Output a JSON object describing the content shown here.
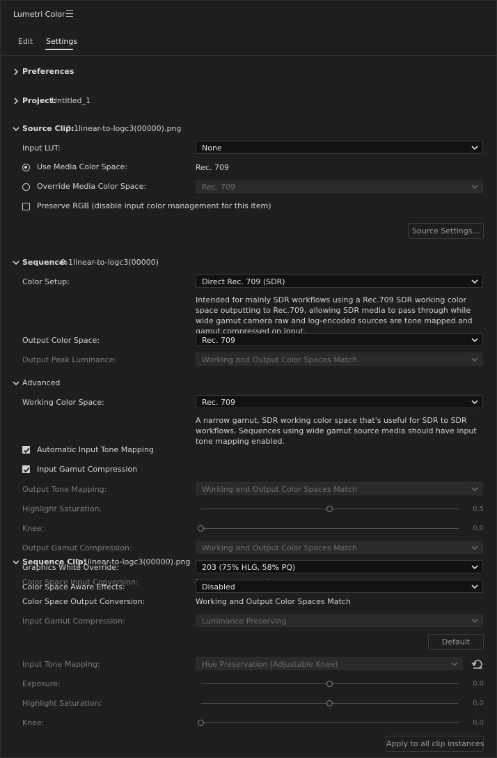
{
  "header": {
    "title": "Lumetri Color"
  },
  "tabs": [
    {
      "label": "Edit"
    },
    {
      "label": "Settings"
    }
  ],
  "sections": {
    "preferences": {
      "label": "Preferences"
    },
    "project": {
      "label": "Project:",
      "value": "Untitled_1"
    },
    "source_clip": {
      "label": "Source Clip:",
      "value": "0-1linear-to-logc3(00000).png",
      "input_lut_label": "Input LUT:",
      "input_lut_value": "None",
      "use_media_label": "Use Media Color Space:",
      "use_media_value": "Rec. 709",
      "override_label": "Override Media Color Space:",
      "override_value": "Rec. 709",
      "preserve_rgb_label": "Preserve RGB (disable input color management for this item)",
      "source_settings_button": "Source Settings..."
    },
    "sequence": {
      "label": "Sequence:",
      "value": "0-1linear-to-logc3(00000)",
      "color_setup_label": "Color Setup:",
      "color_setup_value": "Direct Rec. 709 (SDR)",
      "color_setup_desc": "Intended for mainly SDR workflows using a Rec.709 SDR working color space outputting to Rec.709, allowing SDR media to pass through while wide gamut camera raw and log-encoded sources are tone mapped and gamut compressed on input.",
      "output_cs_label": "Output Color Space:",
      "output_cs_value": "Rec. 709",
      "peak_lum_label": "Output Peak Luminance:",
      "peak_lum_value": "Working and Output Color Spaces Match"
    },
    "advanced": {
      "label": "Advanced",
      "working_cs_label": "Working Color Space:",
      "working_cs_value": "Rec. 709",
      "working_cs_desc": "A narrow gamut, SDR working color space that's useful for SDR to SDR workflows. Sequences using wide gamut source media should have input tone mapping enabled.",
      "auto_tone_label": "Automatic Input Tone Mapping",
      "gamut_comp_label": "Input Gamut Compression",
      "out_tone_label": "Output Tone Mapping:",
      "out_tone_value": "Working and Output Color Spaces Match",
      "highlight_sat_label": "Highlight Saturation:",
      "highlight_sat_value": "0,5",
      "highlight_sat_level": 0.5,
      "knee_label": "Knee:",
      "knee_value": "0,0",
      "knee_level": 0.0,
      "out_gamut_label": "Output Gamut Compression:",
      "out_gamut_value": "Working and Output Color Spaces Match",
      "gfx_white_label": "Graphics White Override:",
      "gfx_white_value": "203 (75% HLG, 58% PQ)",
      "cs_aware_label": "Color Space Aware Effects:",
      "cs_aware_value": "Disabled"
    },
    "seq_clip": {
      "label": "Sequence Clip:",
      "value": "0-1linear-to-logc3(00000).png",
      "cs_input_conv_label": "Color Space Input Conversion:",
      "cs_input_conv_value": "Not color managed",
      "cs_output_conv_label": "Color Space Output Conversion:",
      "cs_output_conv_value": "Working and Output Color Spaces Match",
      "input_gamut_label": "Input Gamut Compression:",
      "input_gamut_value": "Luminance Preserving",
      "default_button": "Default",
      "input_tone_label": "Input Tone Mapping:",
      "input_tone_value": "Hue Preservation (Adjustable Knee)",
      "exposure_label": "Exposure:",
      "exposure_value": "0,0",
      "exposure_level": 0.5,
      "hs_label": "Highlight Saturation:",
      "hs_value": "0,0",
      "hs_level": 0.5,
      "knee_label": "Knee:",
      "knee_value": "0,0",
      "knee_level": 0.0,
      "apply_button": "Apply to all clip instances"
    }
  }
}
